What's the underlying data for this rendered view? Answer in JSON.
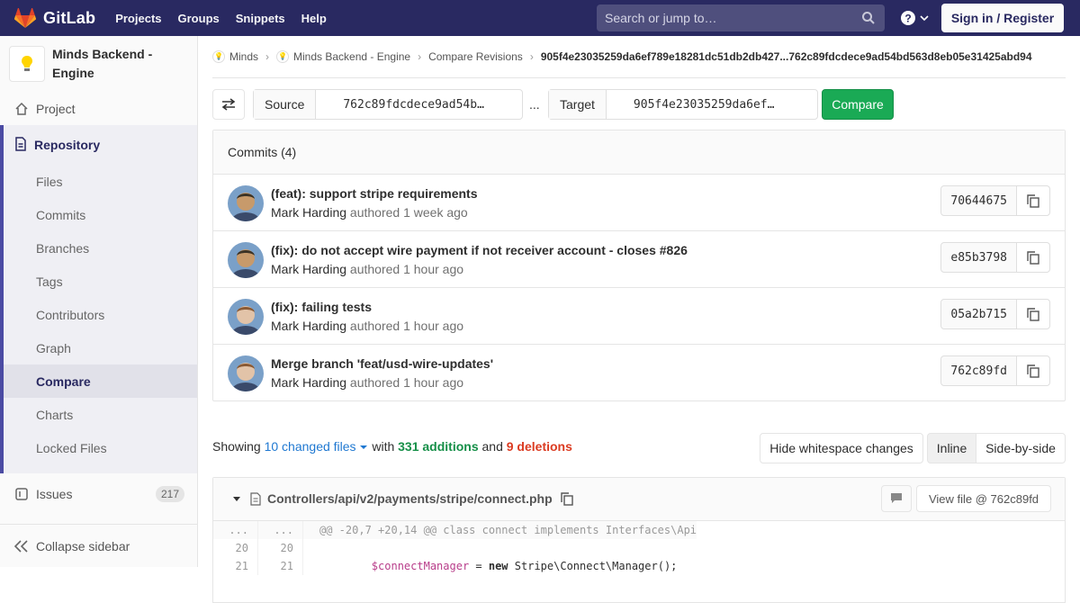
{
  "navbar": {
    "brand": "GitLab",
    "links": [
      "Projects",
      "Groups",
      "Snippets",
      "Help"
    ],
    "search_placeholder": "Search or jump to…",
    "signin": "Sign in / Register"
  },
  "sidebar": {
    "project_name": "Minds Backend - Engine",
    "project": "Project",
    "repository": "Repository",
    "repo_items": [
      "Files",
      "Commits",
      "Branches",
      "Tags",
      "Contributors",
      "Graph",
      "Compare",
      "Charts",
      "Locked Files"
    ],
    "active_item": "Compare",
    "issues": "Issues",
    "issues_count": "217",
    "collapse": "Collapse sidebar"
  },
  "breadcrumb": {
    "items": [
      "Minds",
      "Minds Backend - Engine",
      "Compare Revisions"
    ],
    "current": "905f4e23035259da6ef789e18281dc51db2db427...762c89fdcdece9ad54bd563d8eb05e31425abd94"
  },
  "compare": {
    "source_label": "Source",
    "source_value": "762c89fdcdece9ad54b…",
    "dots": "...",
    "target_label": "Target",
    "target_value": "905f4e23035259da6ef…",
    "button": "Compare"
  },
  "commits": {
    "header": "Commits (4)",
    "items": [
      {
        "title": "(feat): support stripe requirements",
        "author": "Mark Harding",
        "time": "authored 1 week ago",
        "sha": "70644675"
      },
      {
        "title": "(fix): do not accept wire payment if not receiver account - closes #826",
        "author": "Mark Harding",
        "time": "authored 1 hour ago",
        "sha": "e85b3798"
      },
      {
        "title": "(fix): failing tests",
        "author": "Mark Harding",
        "time": "authored 1 hour ago",
        "sha": "05a2b715"
      },
      {
        "title": "Merge branch 'feat/usd-wire-updates'",
        "author": "Mark Harding",
        "time": "authored 1 hour ago",
        "sha": "762c89fd"
      }
    ]
  },
  "diff_stats": {
    "showing": "Showing",
    "changed": "10 changed files",
    "with": "with",
    "additions": "331 additions",
    "and": "and",
    "deletions": "9 deletions",
    "hide_ws": "Hide whitespace changes",
    "inline": "Inline",
    "side_by_side": "Side-by-side"
  },
  "file": {
    "path": "Controllers/api/v2/payments/stripe/connect.php",
    "view_file": "View file @ 762c89fd",
    "lines": [
      {
        "old": "...",
        "new": "...",
        "code": "@@ -20,7 +20,14 @@ class connect implements Interfaces\\Api"
      },
      {
        "old": "20",
        "new": "20",
        "code": ""
      },
      {
        "old": "21",
        "new": "21",
        "code": "        $connectManager = new Stripe\\Connect\\Manager();"
      }
    ]
  },
  "colors": {
    "navbar": "#292961",
    "compare_button": "#1aaa55",
    "additions": "#168f48",
    "deletions": "#db3b21",
    "link": "#1f78d1"
  }
}
